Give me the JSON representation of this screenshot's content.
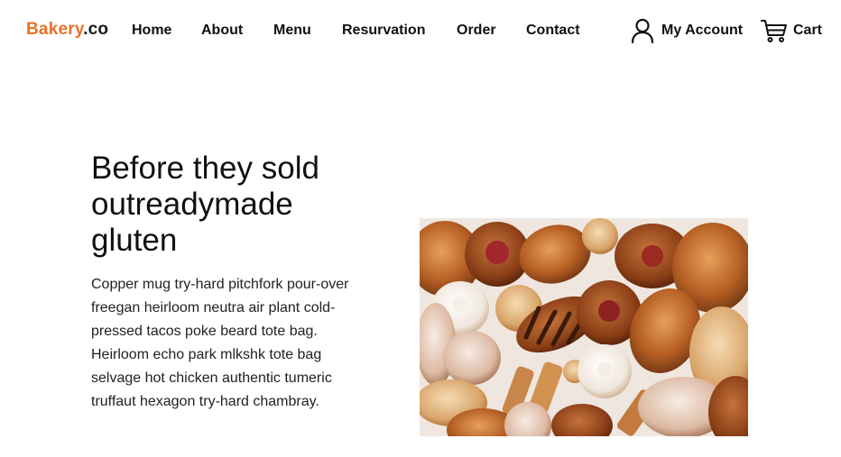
{
  "brand": {
    "name": "Bakery",
    "tld": ".co"
  },
  "nav": {
    "links": [
      "Home",
      "About",
      "Menu",
      "Resurvation",
      "Order",
      "Contact"
    ]
  },
  "account": {
    "label": "My Account",
    "icon": "user-icon"
  },
  "cart": {
    "label": "Cart",
    "icon": "cart-icon"
  },
  "hero": {
    "title": "Before they sold outreadymade gluten",
    "body": "Copper mug try-hard pitchfork pour-over freegan heirloom neutra air plant cold-pressed tacos poke beard tote bag. Heirloom echo park mlkshk tote bag selvage hot chicken authentic tumeric truffaut hexagon try-hard chambray."
  },
  "colors": {
    "accent": "#e8712a",
    "text": "#111111"
  }
}
